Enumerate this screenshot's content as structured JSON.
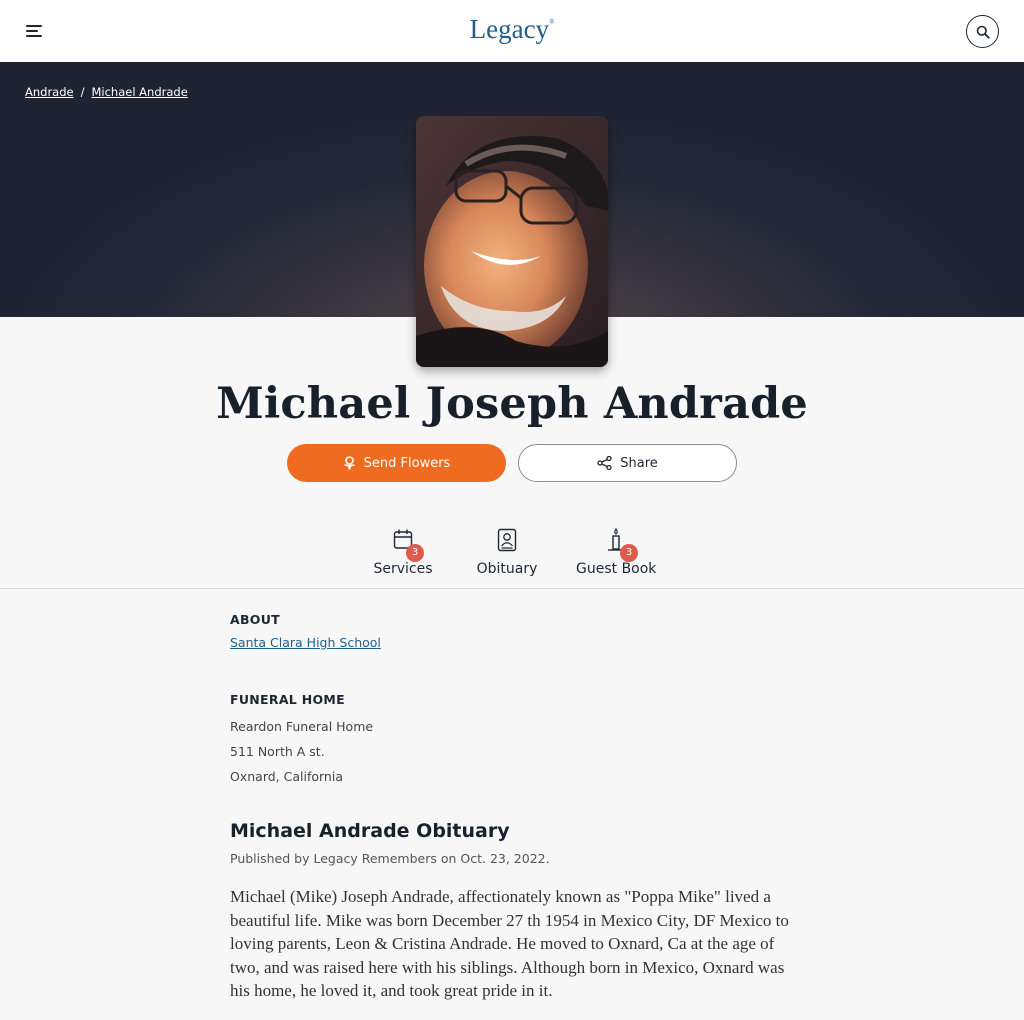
{
  "header": {
    "logo_text": "Legacy",
    "logo_mark": "®",
    "menu_icon": "hamburger-menu-icon",
    "search_icon": "search-icon"
  },
  "breadcrumb": {
    "items": [
      {
        "label": "Andrade"
      },
      {
        "label": "Michael Andrade"
      }
    ],
    "separator": "/"
  },
  "profile": {
    "name": "Michael Joseph Andrade",
    "photo_alt": "Portrait photo of Michael Joseph Andrade"
  },
  "actions": {
    "send_flowers_label": "Send Flowers",
    "send_flowers_icon": "flower-icon",
    "share_label": "Share",
    "share_icon": "share-icon",
    "accent_color": "#ee6b1f"
  },
  "tabs": [
    {
      "label": "Services",
      "icon": "calendar-icon",
      "badge": "3"
    },
    {
      "label": "Obituary",
      "icon": "obituary-icon",
      "badge": ""
    },
    {
      "label": "Guest Book",
      "icon": "candle-icon",
      "badge": "3"
    }
  ],
  "about": {
    "title": "ABOUT",
    "school": "Santa Clara High School"
  },
  "funeral_home": {
    "title": "FUNERAL HOME",
    "name": "Reardon Funeral Home",
    "address": "511 North A st.",
    "city": "Oxnard, California"
  },
  "obituary": {
    "title": "Michael Andrade Obituary",
    "published": "Published by Legacy Remembers on Oct. 23, 2022.",
    "text": "Michael (Mike) Joseph Andrade, affectionately known as \"Poppa Mike\" lived a beautiful life. Mike was born December 27 th 1954 in Mexico City, DF Mexico to loving parents, Leon & Cristina Andrade. He moved to Oxnard, Ca at the age of two, and was raised here with his siblings. Although born in Mexico, Oxnard was his home, he loved it, and took great pride in it."
  }
}
